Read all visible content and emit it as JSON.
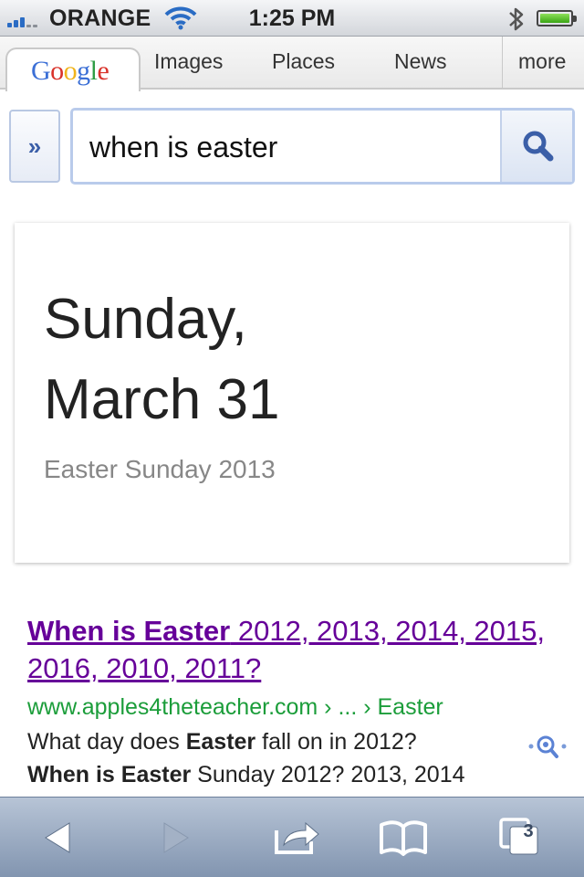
{
  "status_bar": {
    "carrier": "ORANGE",
    "time": "1:25 PM",
    "signal_bars": 3,
    "battery_level": 1.0
  },
  "tabs": {
    "google": "Google",
    "items": [
      "Images",
      "Places",
      "News",
      "more"
    ]
  },
  "search": {
    "expand_label": "»",
    "query": "when is easter"
  },
  "answer": {
    "line1": "Sunday,",
    "line2": "March 31",
    "subtitle": "Easter Sunday 2013"
  },
  "result": {
    "title_bold": "When is Easter",
    "title_rest": " 2012, 2013, 2014, 2015, 2016, 2010, 2011?",
    "url": "www.apples4theteacher.com › ... › Easter",
    "snippet_a": "What day does ",
    "snippet_b": "Easter",
    "snippet_c": " fall on in 2012?",
    "snippet_d": "When is Easter",
    "snippet_e": " Sunday 2012? 2013, 2014"
  },
  "toolbar": {
    "tab_count": "3"
  },
  "colors": {
    "link_visited": "#660099",
    "url_green": "#1b9d3a",
    "accent_blue": "#3b5fa8",
    "toolbar_top": "#b7c4d6"
  },
  "icons": [
    "wifi-icon",
    "bluetooth-icon",
    "battery-icon",
    "search-icon",
    "preview-icon",
    "back-icon",
    "forward-icon",
    "share-icon",
    "bookmarks-icon",
    "pages-icon"
  ]
}
